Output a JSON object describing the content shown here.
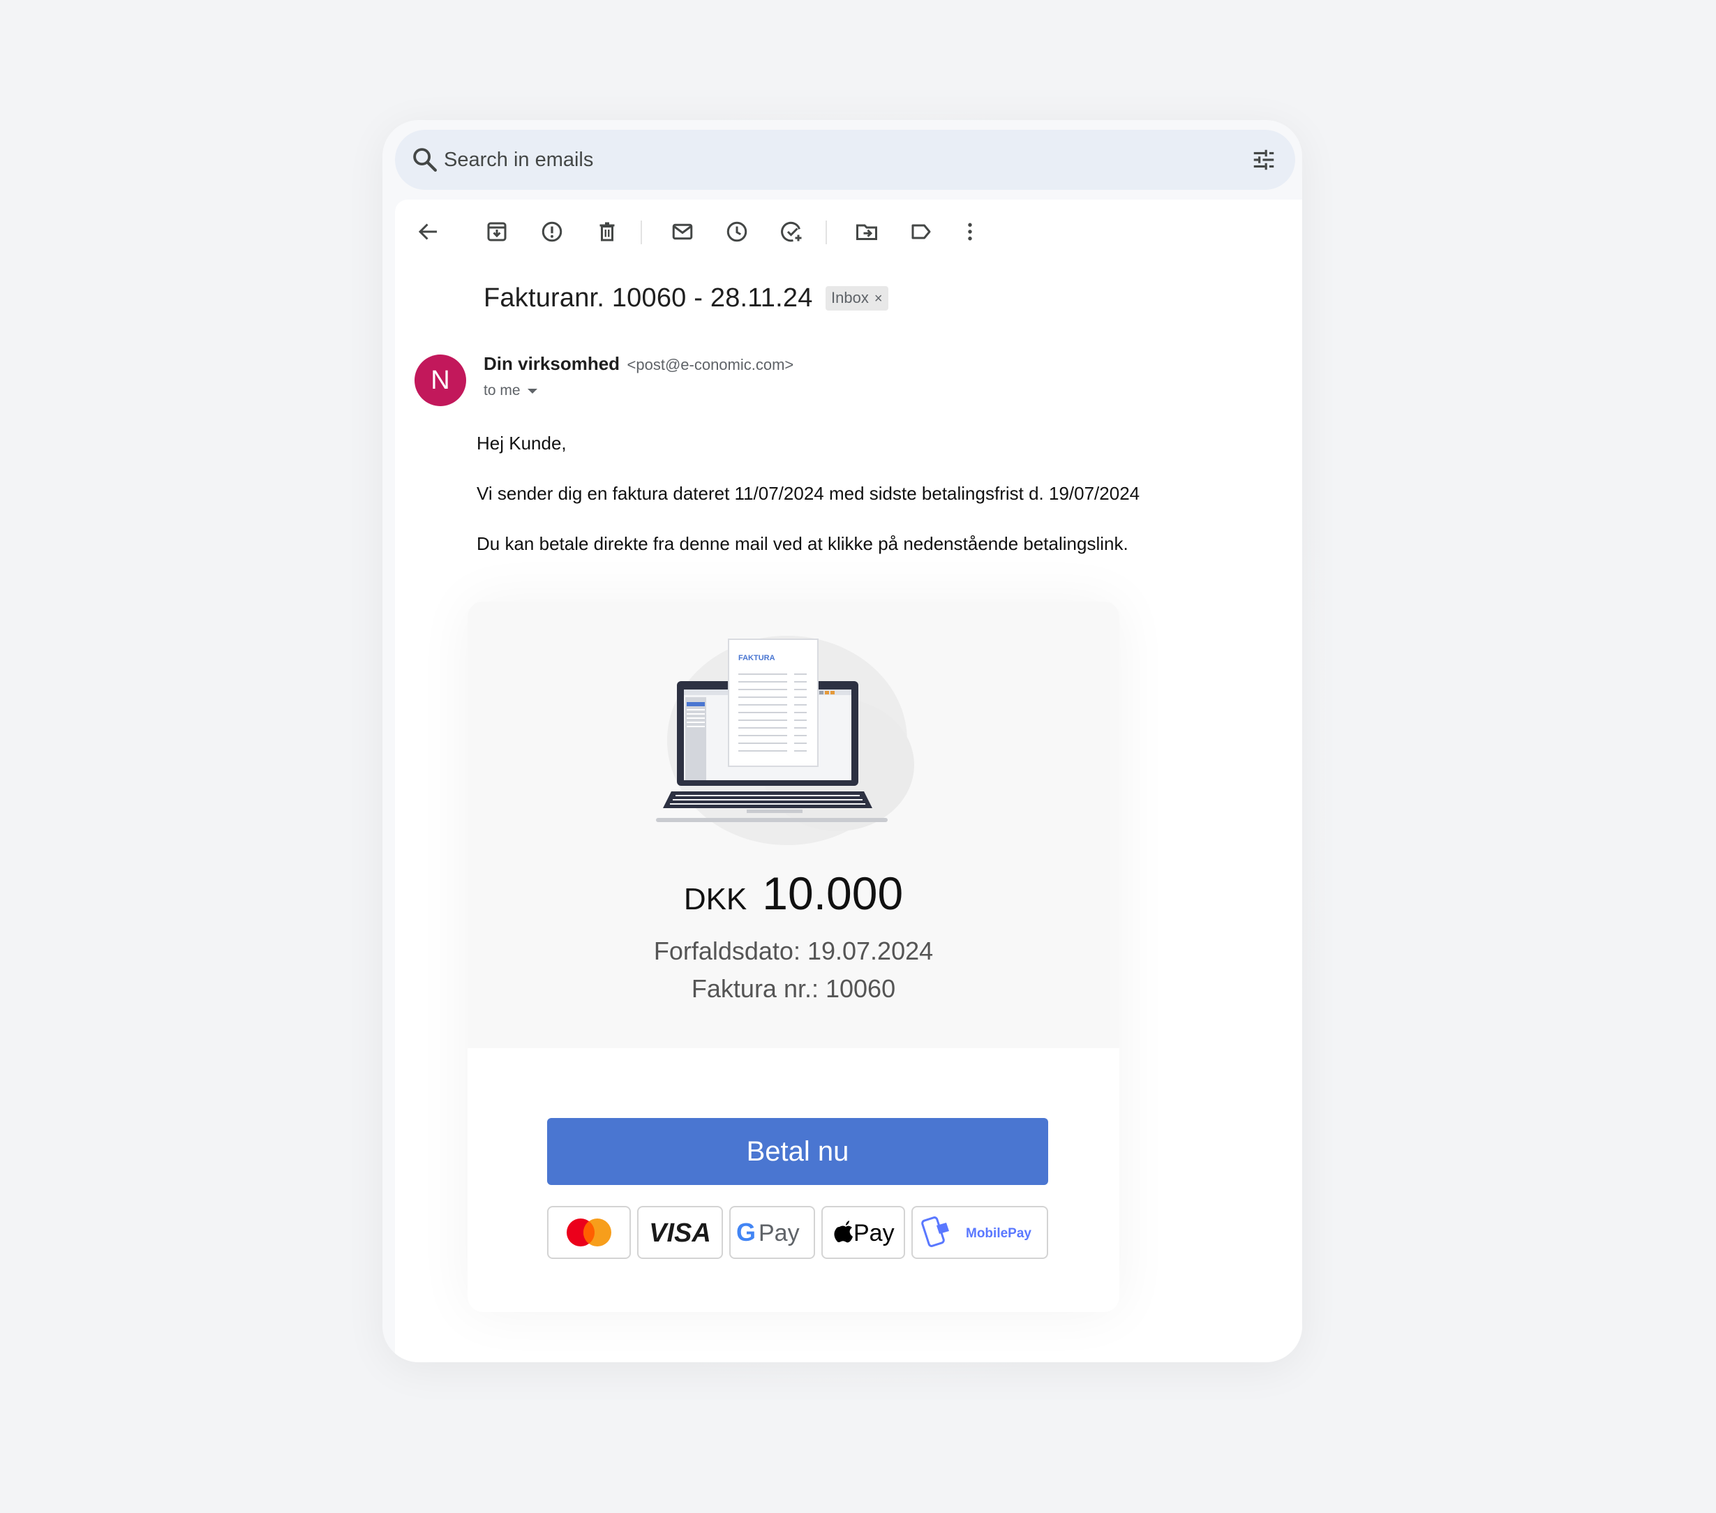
{
  "search": {
    "placeholder": "Search in emails"
  },
  "toolbar": {
    "icons": [
      "back-arrow-icon",
      "archive-icon",
      "report-spam-icon",
      "delete-icon",
      "mark-unread-icon",
      "snooze-icon",
      "add-to-tasks-icon",
      "move-to-icon",
      "label-icon",
      "more-options-icon"
    ]
  },
  "email": {
    "subject": "Fakturanr. 10060 - 28.11.24",
    "label_chip": "Inbox",
    "label_chip_close": "×",
    "sender": {
      "avatar_letter": "N",
      "avatar_color": "#c2185b",
      "name": "Din virksomhed",
      "email": "<post@e-conomic.com>"
    },
    "recipient_label": "to me",
    "greeting": "Hej Kunde,",
    "paragraph_1": "Vi sender dig en faktura dateret 11/07/2024 med sidste betalingsfrist d. 19/07/2024",
    "paragraph_2": "Du kan betale direkte fra denne mail ved at klikke på nedenstående betalingslink."
  },
  "invoice_card": {
    "illustration_label": "FAKTURA",
    "currency": "DKK",
    "amount": "10.000",
    "due_date": "Forfaldsdato: 19.07.2024",
    "invoice_number": "Faktura nr.: 10060",
    "pay_button": "Betal nu",
    "pay_button_color": "#4a76d1",
    "payment_methods": {
      "visa": "VISA",
      "google_pay": "Pay",
      "apple_pay": "Pay",
      "mobilepay": "MobilePay"
    }
  }
}
